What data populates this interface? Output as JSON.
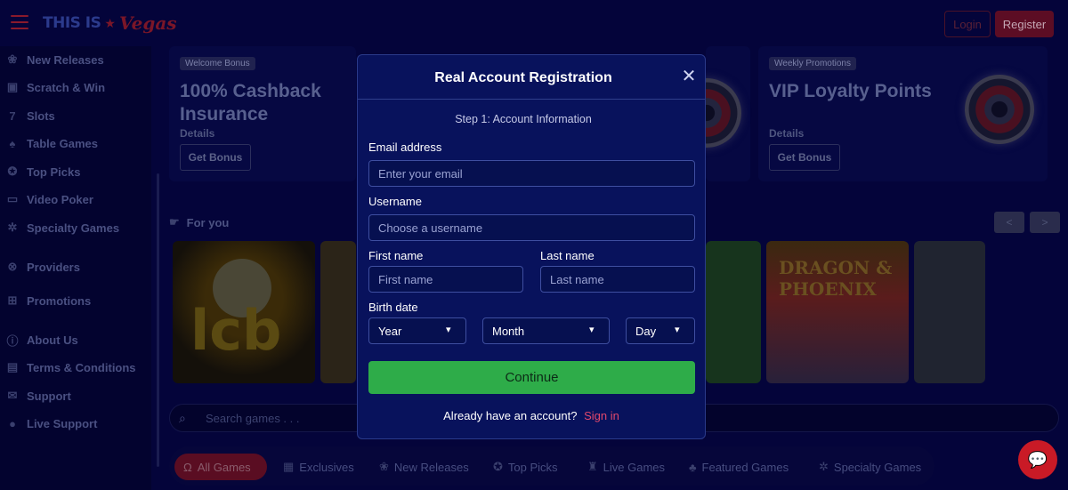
{
  "header": {
    "logo_part1": "THIS IS",
    "logo_part2": "Vegas",
    "login_label": "Login",
    "register_label": "Register"
  },
  "sidebar": {
    "items": [
      {
        "label": "New Releases",
        "icon": "cherries-icon"
      },
      {
        "label": "Scratch & Win",
        "icon": "scratch-card-icon"
      },
      {
        "label": "Slots",
        "icon": "seven-icon"
      },
      {
        "label": "Table Games",
        "icon": "cards-icon"
      },
      {
        "label": "Top Picks",
        "icon": "award-icon"
      },
      {
        "label": "Video Poker",
        "icon": "monitor-icon"
      },
      {
        "label": "Specialty Games",
        "icon": "gear-icon"
      },
      {
        "label": "Providers",
        "icon": "chip-icon"
      },
      {
        "label": "Promotions",
        "icon": "gift-icon"
      },
      {
        "label": "About Us",
        "icon": "info-icon"
      },
      {
        "label": "Terms & Conditions",
        "icon": "document-icon"
      },
      {
        "label": "Support",
        "icon": "envelope-icon"
      },
      {
        "label": "Live Support",
        "icon": "chat-icon"
      }
    ]
  },
  "promos": [
    {
      "badge": "Welcome Bonus",
      "title": "100% Cashback Insurance",
      "details": "Details",
      "button": "Get Bonus"
    },
    {
      "badge": "Weekly Promotions",
      "title": "VIP Loyalty Points",
      "details": "Details",
      "button": "Get Bonus"
    }
  ],
  "for_you": {
    "title": "For you",
    "prev": "<",
    "next": ">",
    "tiles": [
      {
        "text": "lcb"
      },
      {
        "text": "DRAGON & PHOENIX"
      }
    ]
  },
  "search": {
    "placeholder": "Search games . . ."
  },
  "tabs": [
    {
      "label": "All Games",
      "icon": "horseshoe-icon",
      "active": true
    },
    {
      "label": "Exclusives",
      "icon": "badge-icon",
      "active": false
    },
    {
      "label": "New Releases",
      "icon": "cherries-icon",
      "active": false
    },
    {
      "label": "Top Picks",
      "icon": "award-icon",
      "active": false
    },
    {
      "label": "Live Games",
      "icon": "dealer-icon",
      "active": false
    },
    {
      "label": "Featured Games",
      "icon": "clover-icon",
      "active": false
    },
    {
      "label": "Specialty Games",
      "icon": "gear-icon",
      "active": false
    }
  ],
  "modal": {
    "title": "Real Account Registration",
    "step": "Step 1: Account Information",
    "email_label": "Email address",
    "email_placeholder": "Enter your email",
    "username_label": "Username",
    "username_placeholder": "Choose a username",
    "firstname_label": "First name",
    "firstname_placeholder": "First name",
    "lastname_label": "Last name",
    "lastname_placeholder": "Last name",
    "birthdate_label": "Birth date",
    "year": "Year",
    "month": "Month",
    "day": "Day",
    "continue_label": "Continue",
    "already_text": "Already have an account?",
    "signin_label": "Sign in"
  },
  "colors": {
    "background": "#04043a",
    "modal_bg": "#08125c",
    "continue_green": "#2eac49",
    "link_pink": "#e2486b",
    "register_red": "#5c0d24",
    "chat_red": "#c91a26"
  }
}
